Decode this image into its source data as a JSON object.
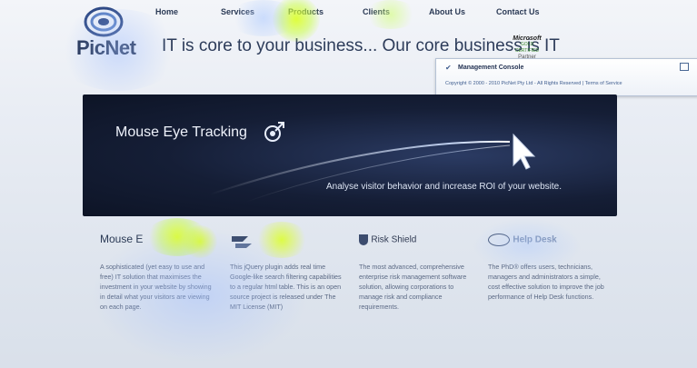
{
  "nav": {
    "items": [
      "Home",
      "Services",
      "Products",
      "Clients",
      "About Us",
      "Contact Us"
    ]
  },
  "logo": {
    "name": "PicNet"
  },
  "tagline": "IT is core to your business... Our core business is IT",
  "badge": {
    "brand": "Microsoft",
    "line1": "GOLD CERTIFIED",
    "line2": "Partner"
  },
  "console": {
    "title": "Management Console",
    "copyright": "Copyright © 2000 - 2010 PicNet Pty Ltd - All Rights Reserved",
    "terms": "Terms of Service"
  },
  "hero": {
    "title": "Mouse Eye Tracking",
    "subtitle": "Analyse visitor behavior and increase ROI of your website."
  },
  "columns": [
    {
      "heading": "Mouse E",
      "text": "A sophisticated (yet easy to use and free) IT solution that maximises the investment in your website by showing in detail what your visitors are viewing on each page."
    },
    {
      "heading": "",
      "text": "This jQuery plugin adds real time Google-like search filtering capabilities to a regular html table. This is an open source project is released under The MIT License (MIT)"
    },
    {
      "heading": "Risk Shield",
      "text": "The most advanced, comprehensive enterprise risk management software solution, allowing corporations to manage risk and compliance requirements."
    },
    {
      "heading": "Help Desk",
      "text": "The PhD® offers users, technicians, managers and administrators a simple, cost effective solution to improve the job performance of Help Desk functions."
    }
  ]
}
